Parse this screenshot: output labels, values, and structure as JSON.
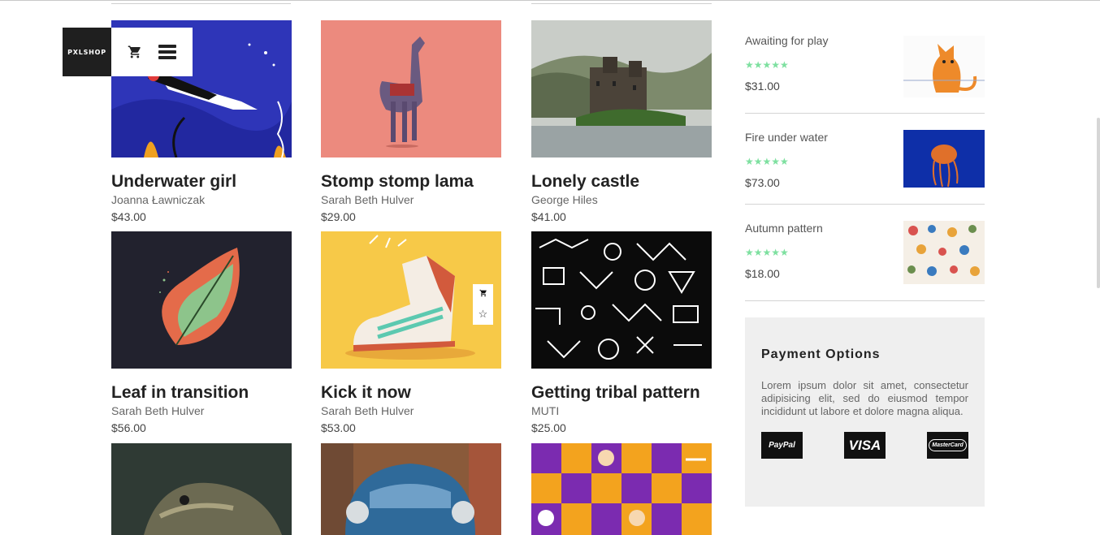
{
  "brand": {
    "logo_text": "PXLSHOP"
  },
  "nav": {
    "cart_icon": "cart-icon",
    "menu_icon": "hamburger-menu-icon"
  },
  "products": [
    {
      "title": "Underwater girl",
      "author": "Joanna Ławniczak",
      "price": "$43.00"
    },
    {
      "title": "Stomp stomp lama",
      "author": "Sarah Beth Hulver",
      "price": "$29.00"
    },
    {
      "title": "Lonely castle",
      "author": "George Hiles",
      "price": "$41.00"
    },
    {
      "title": "Leaf in transition",
      "author": "Sarah Beth Hulver",
      "price": "$56.00"
    },
    {
      "title": "Kick it now",
      "author": "Sarah Beth Hulver",
      "price": "$53.00"
    },
    {
      "title": "Getting tribal pattern",
      "author": "MUTI",
      "price": "$25.00"
    }
  ],
  "product_actions": {
    "cart_icon": "cart-icon",
    "favorite_icon": "star-outline-icon"
  },
  "sidebar": {
    "items": [
      {
        "name": "Awaiting for play",
        "rating": "★★★★★",
        "price": "$31.00"
      },
      {
        "name": "Fire under water",
        "rating": "★★★★★",
        "price": "$73.00"
      },
      {
        "name": "Autumn pattern",
        "rating": "★★★★★",
        "price": "$18.00"
      }
    ]
  },
  "payment": {
    "title": "Payment Options",
    "text": "Lorem ipsum dolor sit amet, consectetur adipisicing elit, sed do eiusmod tempor incididunt ut labore et dolore magna aliqua.",
    "logos": [
      "PayPal",
      "VISA",
      "MasterCard"
    ]
  },
  "colors": {
    "accent_star": "#7ee0a0",
    "brand_bg": "#1f1f1f",
    "panel_bg": "#efefef"
  }
}
